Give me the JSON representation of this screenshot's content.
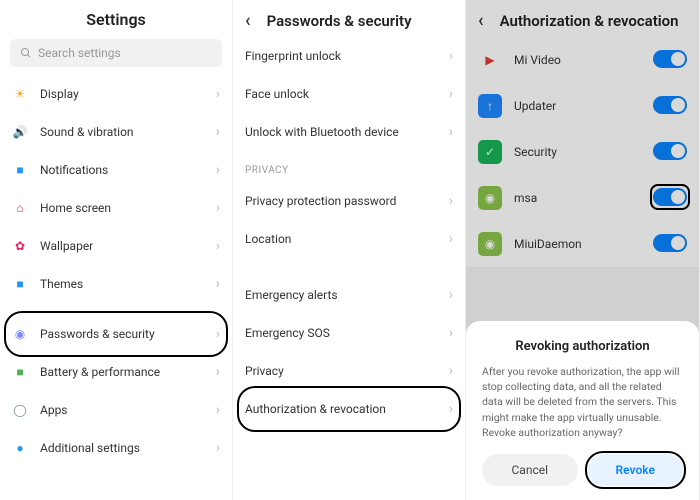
{
  "panel1": {
    "title": "Settings",
    "search_placeholder": "Search settings",
    "items": [
      {
        "label": "Display",
        "icon": "☀"
      },
      {
        "label": "Sound & vibration",
        "icon": "🔊"
      },
      {
        "label": "Notifications",
        "icon": "■"
      },
      {
        "label": "Home screen",
        "icon": "⌂"
      },
      {
        "label": "Wallpaper",
        "icon": "✿"
      },
      {
        "label": "Themes",
        "icon": "■"
      },
      {
        "label": "Passwords & security",
        "icon": "◉",
        "highlight": true
      },
      {
        "label": "Battery & performance",
        "icon": "■"
      },
      {
        "label": "Apps",
        "icon": "◯"
      },
      {
        "label": "Additional settings",
        "icon": "●"
      }
    ]
  },
  "panel2": {
    "title": "Passwords & security",
    "groups": [
      {
        "header": null,
        "items": [
          {
            "label": "Fingerprint unlock"
          },
          {
            "label": "Face unlock"
          },
          {
            "label": "Unlock with Bluetooth device"
          }
        ]
      },
      {
        "header": "PRIVACY",
        "items": [
          {
            "label": "Privacy protection password"
          },
          {
            "label": "Location"
          }
        ]
      },
      {
        "header": null,
        "items": [
          {
            "label": "Emergency alerts"
          },
          {
            "label": "Emergency SOS"
          },
          {
            "label": "Privacy"
          },
          {
            "label": "Authorization & revocation",
            "highlight": true
          }
        ]
      }
    ]
  },
  "panel3": {
    "title": "Authorization & revocation",
    "apps": [
      {
        "label": "Mi Video",
        "bg": "#fff",
        "fg": "▶"
      },
      {
        "label": "Updater",
        "bg": "#1e88ff",
        "fg": "↑"
      },
      {
        "label": "Security",
        "bg": "#17b35a",
        "fg": "✓"
      },
      {
        "label": "msa",
        "bg": "#8bc34a",
        "fg": "◉",
        "highlight": true
      },
      {
        "label": "MiuiDaemon",
        "bg": "#8bc34a",
        "fg": "◉"
      }
    ],
    "dialog": {
      "title": "Revoking authorization",
      "body": "After you revoke authorization, the app will stop collecting data, and all the related data will be deleted from the servers. This might make the app virtually unusable. Revoke authorization anyway?",
      "cancel": "Cancel",
      "revoke": "Revoke"
    }
  }
}
